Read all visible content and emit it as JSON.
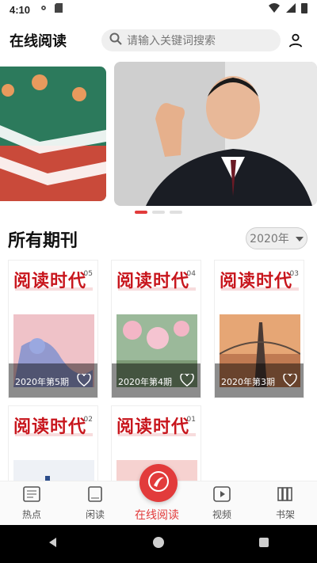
{
  "status": {
    "time": "4:10"
  },
  "header": {
    "title": "在线阅读",
    "search_placeholder": "请输入关键词搜索"
  },
  "section": {
    "title": "所有期刊",
    "year": "2020年"
  },
  "magazines": [
    {
      "label": "2020年第5期",
      "issue": "05"
    },
    {
      "label": "2020年第4期",
      "issue": "04"
    },
    {
      "label": "2020年第3期",
      "issue": "03"
    },
    {
      "label": "",
      "issue": "02"
    },
    {
      "label": "",
      "issue": "01"
    }
  ],
  "magazine_brand": "阅读时代",
  "bottom_nav": {
    "hot": "热点",
    "read": "闲读",
    "online": "在线阅读",
    "video": "视频",
    "shelf": "书架"
  },
  "colors": {
    "accent": "#e23b3b",
    "brand": "#c8161d"
  }
}
